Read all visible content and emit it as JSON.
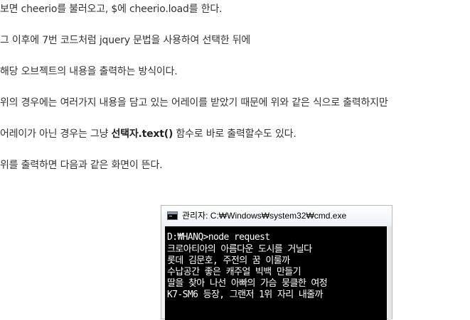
{
  "paragraphs": {
    "p1": "보면 cheerio를 불러오고, $에 cheerio.load를 한다.",
    "p2": "그 이후에 7번 코드처럼 jquery 문법을 사용하여 선택한 뒤에",
    "p3": "해당 오브젝트의 내용을 출력하는 방식이다.",
    "p4": "위의 경우에는 여러가지 내용을 담고 있는 어레이를 받았기 때문에 위와 같은 식으로 출력하지만",
    "p5": {
      "before": "어레이가 아닌 경우는 그냥 ",
      "bold": "선택자.text()",
      "after": " 함수로 바로 출력할수도 있다."
    },
    "p6": "위를 출력하면 다음과 같은 화면이 뜬다."
  },
  "cmd": {
    "title": "관리자: C:₩Windows₩system32₩cmd.exe",
    "icon": "cmd-console-icon",
    "prompt": "D:₩HANQ>node request",
    "output": [
      "크로아티아의 아름다운 도시를 거닐다",
      "롯데 김문호, 주전의 꿈 이룰까",
      "수납공간 좋은 캐주얼 빅백 만들기",
      "딸을 찾아 나선 아빠의 가슴 뭉클한 여정",
      "K7-SM6 등장, 그랜저 1위 자리 내줄까"
    ]
  }
}
